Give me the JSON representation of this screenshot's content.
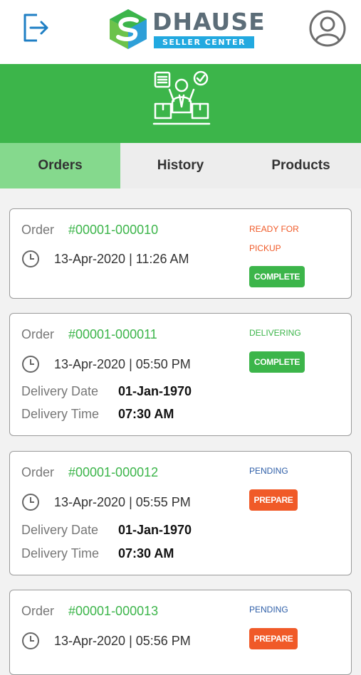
{
  "header": {
    "logo_name": "DHAUSE",
    "logo_subtitle": "SELLER CENTER",
    "logout_icon": "logout-icon",
    "profile_icon": "user-profile-icon"
  },
  "banner": {
    "icon": "seller-with-boxes-icon",
    "color": "#3cb54a"
  },
  "tabs": [
    {
      "label": "Orders",
      "active": true
    },
    {
      "label": "History",
      "active": false
    },
    {
      "label": "Products",
      "active": false
    }
  ],
  "labels": {
    "order": "Order",
    "delivery_date": "Delivery Date",
    "delivery_time": "Delivery Time"
  },
  "orders": [
    {
      "number": "#00001-000010",
      "datetime": "13-Apr-2020 | 11:26 AM",
      "status_line1": "READY FOR",
      "status_line2": "PICKUP",
      "status_color": "#f05a28",
      "action": "COMPLETE",
      "action_color": "#3cb54a"
    },
    {
      "number": "#00001-000011",
      "datetime": "13-Apr-2020 | 05:50 PM",
      "status_line1": "DELIVERING",
      "status_color": "#3cb54a",
      "action": "COMPLETE",
      "action_color": "#3cb54a",
      "delivery_date": "01-Jan-1970",
      "delivery_time": "07:30 AM"
    },
    {
      "number": "#00001-000012",
      "datetime": "13-Apr-2020 | 05:55 PM",
      "status_line1": "PENDING",
      "status_color": "#2f5fa8",
      "action": "PREPARE",
      "action_color": "#f05a28",
      "delivery_date": "01-Jan-1970",
      "delivery_time": "07:30 AM"
    },
    {
      "number": "#00001-000013",
      "datetime": "13-Apr-2020 | 05:56 PM",
      "status_line1": "PENDING",
      "status_color": "#2f5fa8",
      "action": "PREPARE",
      "action_color": "#f05a28"
    }
  ]
}
